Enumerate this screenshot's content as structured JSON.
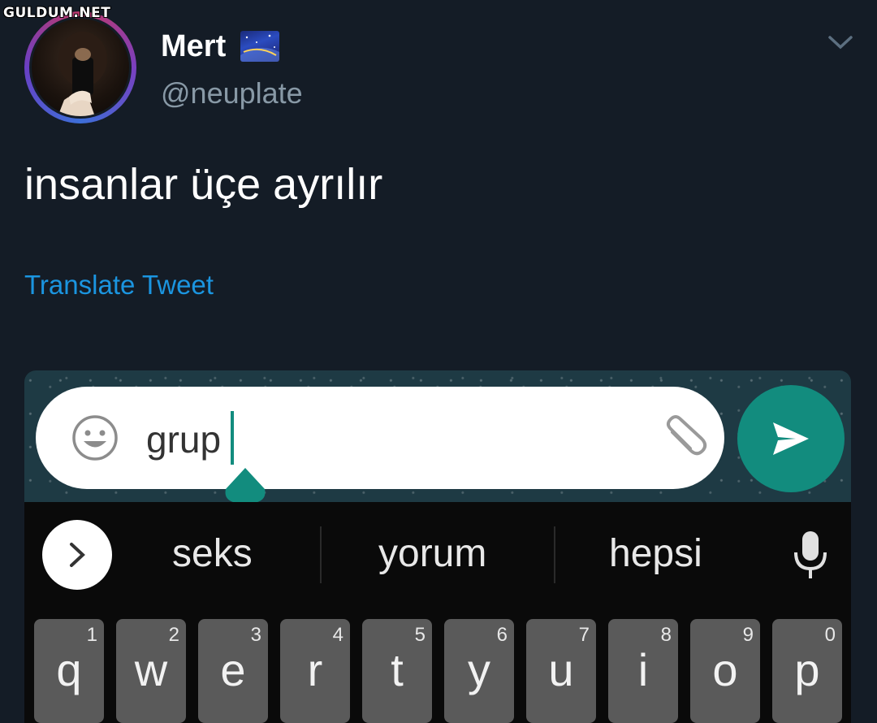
{
  "watermark": "GULDUM.NET",
  "tweet": {
    "display_name": "Mert",
    "handle": "@neuplate",
    "text": "insanlar üçe ayrılır",
    "translate_label": "Translate Tweet"
  },
  "chat_input": {
    "value": "grup",
    "accent_color": "#128c7e"
  },
  "suggestions": [
    "seks",
    "yorum",
    "hepsi"
  ],
  "keyboard": {
    "row1": [
      {
        "letter": "q",
        "hint": "1"
      },
      {
        "letter": "w",
        "hint": "2"
      },
      {
        "letter": "e",
        "hint": "3"
      },
      {
        "letter": "r",
        "hint": "4"
      },
      {
        "letter": "t",
        "hint": "5"
      },
      {
        "letter": "y",
        "hint": "6"
      },
      {
        "letter": "u",
        "hint": "7"
      },
      {
        "letter": "i",
        "hint": "8"
      },
      {
        "letter": "o",
        "hint": "9"
      },
      {
        "letter": "p",
        "hint": "0"
      }
    ]
  },
  "icons": {
    "emoji": "smiley-icon",
    "attach": "paperclip-icon",
    "send": "send-icon",
    "expand": "chevron-right-icon",
    "mic": "microphone-icon",
    "menu": "chevron-down-icon"
  }
}
